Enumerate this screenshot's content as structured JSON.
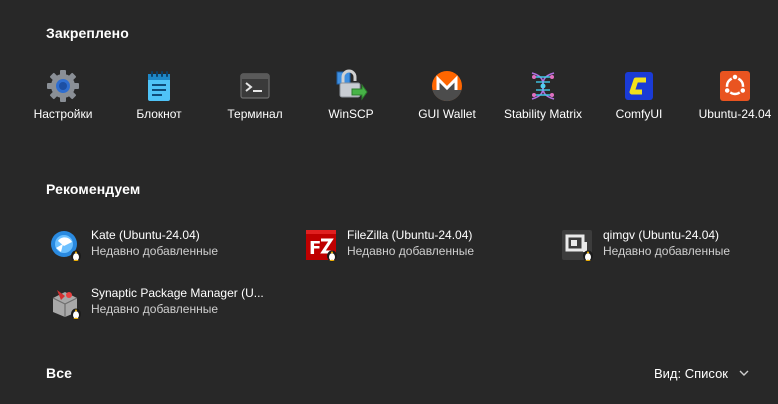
{
  "pinned": {
    "title": "Закреплено",
    "items": [
      {
        "label": "Настройки",
        "icon": "settings-gear-icon"
      },
      {
        "label": "Блокнот",
        "icon": "notepad-icon"
      },
      {
        "label": "Терминал",
        "icon": "terminal-icon"
      },
      {
        "label": "WinSCP",
        "icon": "winscp-icon"
      },
      {
        "label": "GUI Wallet",
        "icon": "monero-icon"
      },
      {
        "label": "Stability Matrix",
        "icon": "stability-matrix-icon"
      },
      {
        "label": "ComfyUI",
        "icon": "comfyui-icon"
      },
      {
        "label": "Ubuntu-24.04",
        "icon": "ubuntu-icon"
      }
    ]
  },
  "recommended": {
    "title": "Рекомендуем",
    "items": [
      {
        "name": "Kate (Ubuntu-24.04)",
        "subtitle": "Недавно добавленные",
        "icon": "kate-icon"
      },
      {
        "name": "FileZilla (Ubuntu-24.04)",
        "subtitle": "Недавно добавленные",
        "icon": "filezilla-icon"
      },
      {
        "name": "qimgv (Ubuntu-24.04)",
        "subtitle": "Недавно добавленные",
        "icon": "qimgv-icon"
      },
      {
        "name": "Synaptic Package Manager (U...",
        "subtitle": "Недавно добавленные",
        "icon": "synaptic-icon"
      }
    ]
  },
  "all": {
    "title": "Все",
    "view_label": "Вид: Список"
  },
  "colors": {
    "background": "#282828",
    "text": "#ffffff",
    "subtext": "#cfcfcf"
  }
}
